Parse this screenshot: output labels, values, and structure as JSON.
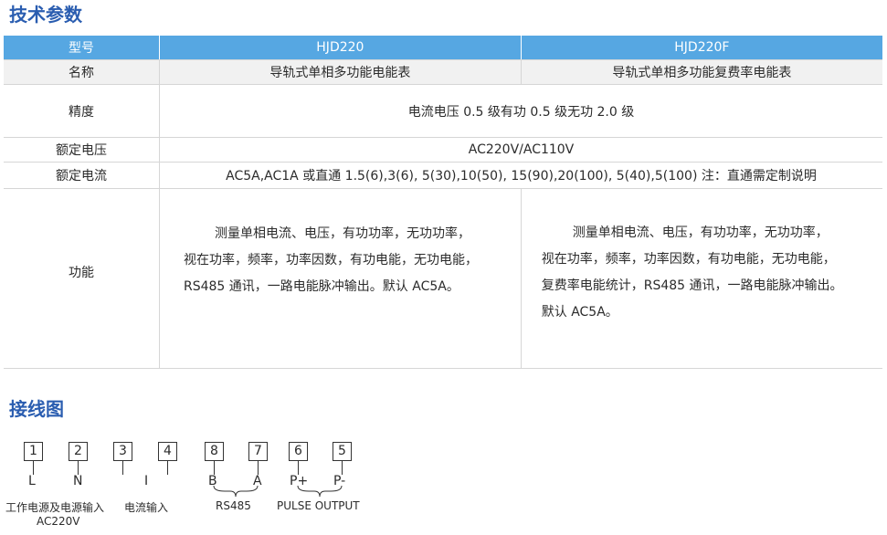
{
  "sections": {
    "specs_title": "技术参数",
    "wiring_title": "接线图"
  },
  "table": {
    "header": {
      "label": "型号",
      "col1": "HJD220",
      "col2": "HJD220F"
    },
    "name_row": {
      "label": "名称",
      "col1": "导轨式单相多功能电能表",
      "col2": "导轨式单相多功能复费率电能表"
    },
    "accuracy_row": {
      "label": "精度",
      "value": "电流电压 0.5 级有功 0.5 级无功 2.0 级"
    },
    "voltage_row": {
      "label": "额定电压",
      "value": "AC220V/AC110V"
    },
    "current_row": {
      "label": "额定电流",
      "value": "AC5A,AC1A 或直通 1.5(6),3(6), 5(30),10(50), 15(90),20(100), 5(40),5(100) 注：直通需定制说明"
    },
    "function_row": {
      "label": "功能",
      "col1": [
        "测量单相电流、电压，有功功率，无功功率，",
        "视在功率，频率，功率因数，有功电能，无功电能，",
        "RS485 通讯，一路电能脉冲输出。默认 AC5A。"
      ],
      "col2": [
        "测量单相电流、电压，有功功率，无功功率，",
        "视在功率，频率，功率因数，有功电能，无功电能，",
        "复费率电能统计，RS485 通讯，一路电能脉冲输出。",
        "默认 AC5A。"
      ]
    }
  },
  "wiring": {
    "terminals": [
      "1",
      "2",
      "3",
      "4",
      "8",
      "7",
      "6",
      "5"
    ],
    "signals": [
      "L",
      "N",
      "I",
      "I",
      "B",
      "A",
      "P+",
      "P-"
    ],
    "group_labels": {
      "power": "工作电源及电源输入",
      "power_sub": "AC220V",
      "current": "电流输入",
      "rs485": "RS485",
      "pulse": "PULSE OUTPUT"
    }
  }
}
